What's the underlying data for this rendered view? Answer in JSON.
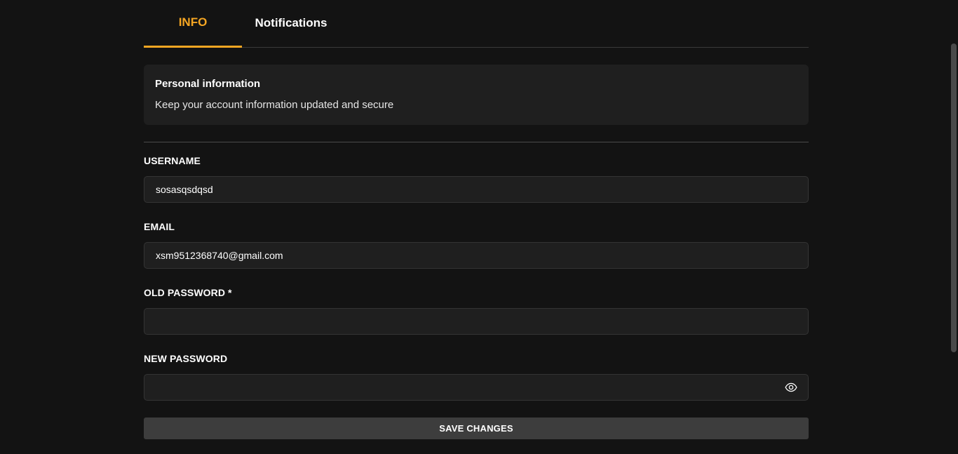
{
  "tabs": [
    {
      "label": "INFO",
      "active": true
    },
    {
      "label": "Notifications",
      "active": false
    }
  ],
  "info_card": {
    "title": "Personal information",
    "subtitle": "Keep your account information updated and secure"
  },
  "form": {
    "username": {
      "label": "USERNAME",
      "value": "sosasqsdqsd"
    },
    "email": {
      "label": "EMAIL",
      "value": "xsm9512368740@gmail.com"
    },
    "old_password": {
      "label": "OLD PASSWORD *",
      "value": ""
    },
    "new_password": {
      "label": "NEW PASSWORD",
      "value": "",
      "toggle_icon": "eye-icon"
    },
    "save_label": "SAVE CHANGES"
  },
  "colors": {
    "accent": "#f5a623",
    "background": "#131313",
    "card": "#1f1f1f",
    "button": "#3d3d3d"
  }
}
